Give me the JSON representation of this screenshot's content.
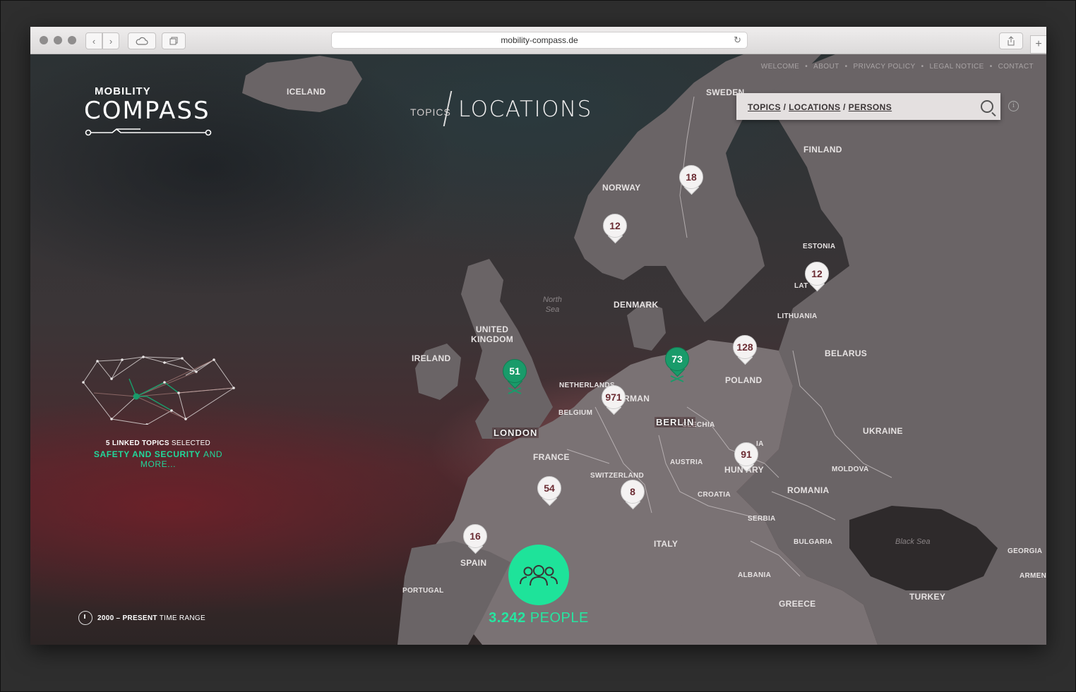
{
  "browser": {
    "url": "mobility-compass.de"
  },
  "nav": [
    "WELCOME",
    "ABOUT",
    "PRIVACY POLICY",
    "LEGAL NOTICE",
    "CONTACT"
  ],
  "logo": {
    "line1": "MOBILITY",
    "line2": "COMPASS"
  },
  "heading": {
    "small": "TOPICS",
    "large": "LOCATIONS"
  },
  "search": {
    "links": [
      "TOPICS",
      "LOCATIONS",
      "PERSONS"
    ],
    "separator": "/"
  },
  "topics": {
    "count_label": "5 LINKED TOPICS",
    "selected_label": "SELECTED",
    "highlight": "SAFETY AND SECURITY",
    "more": "AND MORE..."
  },
  "time_range": {
    "value": "2000 – PRESENT",
    "label": "TIME RANGE"
  },
  "people": {
    "count": "3.242",
    "label": "PEOPLE"
  },
  "countries": {
    "iceland": "ICELAND",
    "sweden": "SWEDEN",
    "finland": "FINLAND",
    "norway": "NORWAY",
    "estonia": "ESTONIA",
    "latvia": "LAT",
    "lithuania": "LITHUANIA",
    "denmark": "DENMARK",
    "uk": "UNITED\nKINGDOM",
    "ireland": "IRELAND",
    "netherlands": "NETHERLANDS",
    "belgium": "BELGIUM",
    "germany": "RMAN",
    "poland": "POLAND",
    "belarus": "BELARUS",
    "czechia": "CZECHIA",
    "ukraine": "UKRAINE",
    "austria": "AUSTRIA",
    "hungary": "HUN ARY",
    "moldova": "MOLDOVA",
    "france": "FRANCE",
    "switzerland": "SWITZERLAND",
    "romania": "ROMANIA",
    "croatia": "CROATIA",
    "serbia": "SERBIA",
    "bulgaria": "BULGARIA",
    "italy": "ITALY",
    "spain": "SPAIN",
    "portugal": "PORTUGAL",
    "albania": "ALBANIA",
    "greece": "GREECE",
    "turkey": "TURKEY",
    "georgia": "GEORGIA",
    "armenia": "ARMENI",
    "slovakia": "IA"
  },
  "seas": {
    "north": "North\nSea",
    "black": "Black Sea"
  },
  "pins": [
    {
      "id": "norway-n",
      "value": "18",
      "style": "white"
    },
    {
      "id": "norway-s",
      "value": "12",
      "style": "white"
    },
    {
      "id": "baltic",
      "value": "12",
      "style": "white"
    },
    {
      "id": "poland",
      "value": "128",
      "style": "white"
    },
    {
      "id": "london",
      "value": "51",
      "style": "green",
      "city": "LONDON"
    },
    {
      "id": "berlin",
      "value": "73",
      "style": "green",
      "city": "BERLIN"
    },
    {
      "id": "germany",
      "value": "971",
      "style": "white"
    },
    {
      "id": "hungary",
      "value": "91",
      "style": "white"
    },
    {
      "id": "france",
      "value": "54",
      "style": "white"
    },
    {
      "id": "italy",
      "value": "8",
      "style": "white"
    },
    {
      "id": "spain",
      "value": "16",
      "style": "white"
    }
  ],
  "colors": {
    "accent": "#1ee39a",
    "pin_green": "#199b6a",
    "pin_text": "#6b2c33"
  }
}
